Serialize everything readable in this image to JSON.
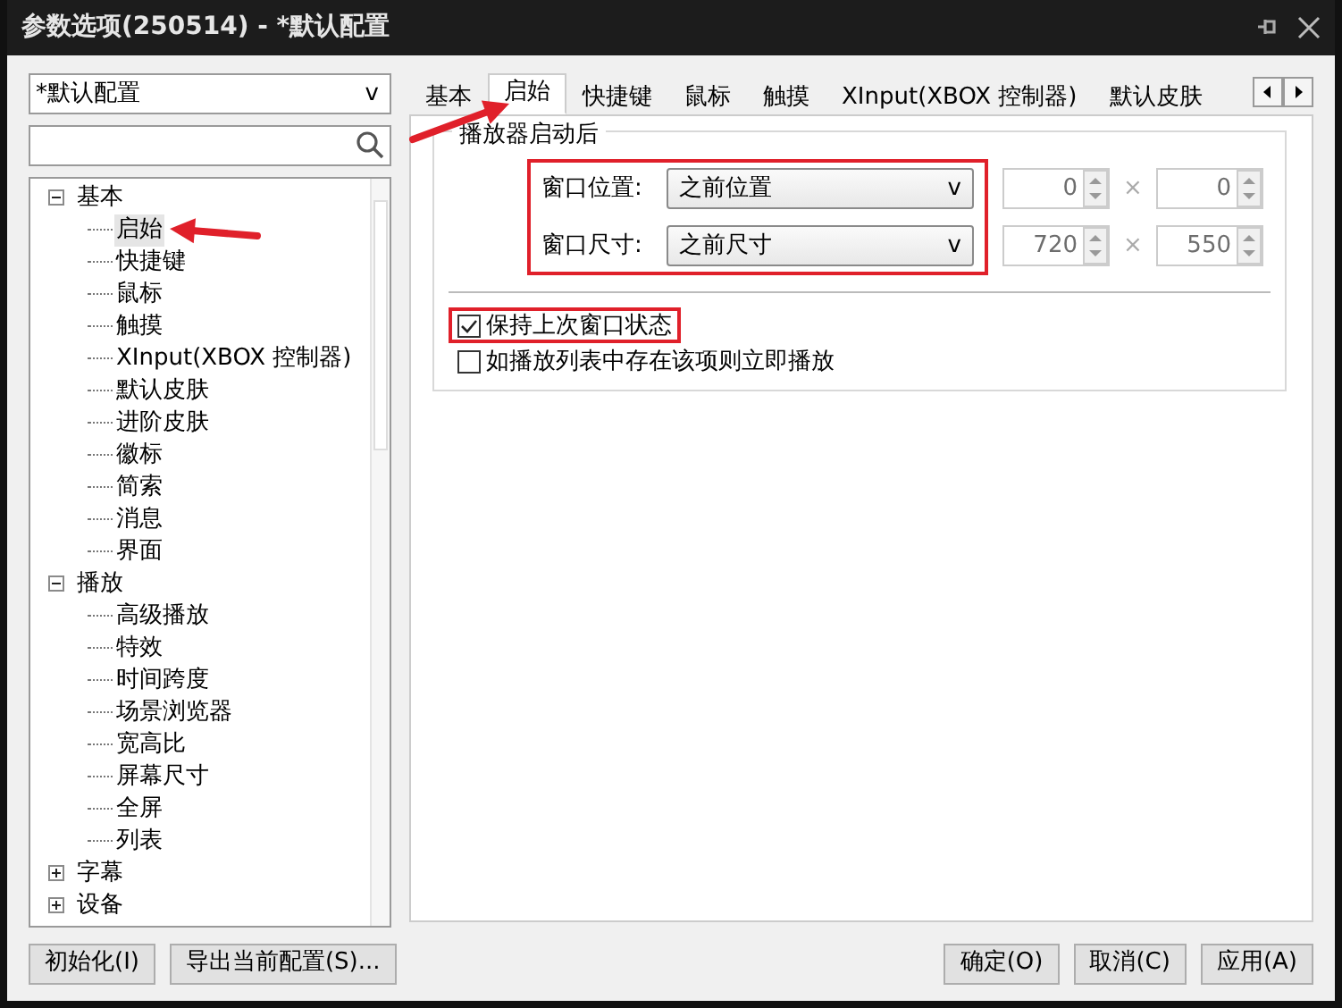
{
  "window": {
    "title": "参数选项(250514) - *默认配置"
  },
  "profile_select": {
    "value": "*默认配置",
    "caret": "v"
  },
  "tree": [
    {
      "label": "基本",
      "expanded": true,
      "selected": false,
      "children": [
        {
          "label": "启始",
          "selected": true
        },
        {
          "label": "快捷键",
          "selected": false
        },
        {
          "label": "鼠标",
          "selected": false
        },
        {
          "label": "触摸",
          "selected": false
        },
        {
          "label": "XInput(XBOX 控制器)",
          "selected": false
        },
        {
          "label": "默认皮肤",
          "selected": false
        },
        {
          "label": "进阶皮肤",
          "selected": false
        },
        {
          "label": "徽标",
          "selected": false
        },
        {
          "label": "简索",
          "selected": false
        },
        {
          "label": "消息",
          "selected": false
        },
        {
          "label": "界面",
          "selected": false
        }
      ]
    },
    {
      "label": "播放",
      "expanded": true,
      "selected": false,
      "children": [
        {
          "label": "高级播放",
          "selected": false
        },
        {
          "label": "特效",
          "selected": false
        },
        {
          "label": "时间跨度",
          "selected": false
        },
        {
          "label": "场景浏览器",
          "selected": false
        },
        {
          "label": "宽高比",
          "selected": false
        },
        {
          "label": "屏幕尺寸",
          "selected": false
        },
        {
          "label": "全屏",
          "selected": false
        },
        {
          "label": "列表",
          "selected": false
        }
      ]
    },
    {
      "label": "字幕",
      "expanded": false,
      "selected": false
    },
    {
      "label": "设备",
      "expanded": false,
      "selected": false
    }
  ],
  "tabs": [
    {
      "label": "基本",
      "selected": false
    },
    {
      "label": "启始",
      "selected": true
    },
    {
      "label": "快捷键",
      "selected": false
    },
    {
      "label": "鼠标",
      "selected": false
    },
    {
      "label": "触摸",
      "selected": false
    },
    {
      "label": "XInput(XBOX 控制器)",
      "selected": false
    },
    {
      "label": "默认皮肤",
      "selected": false
    }
  ],
  "group": {
    "title": "播放器启动后",
    "rows": [
      {
        "label": "窗口位置:",
        "value": "之前位置",
        "caret": "v",
        "spin_a": "0",
        "separator": "×",
        "spin_b": "0",
        "disabled": true
      },
      {
        "label": "窗口尺寸:",
        "value": "之前尺寸",
        "caret": "v",
        "spin_a": "720",
        "separator": "×",
        "spin_b": "550",
        "disabled": true
      }
    ]
  },
  "checkboxes": [
    {
      "label": "保持上次窗口状态",
      "checked": true,
      "highlighted": true
    },
    {
      "label": "如播放列表中存在该项则立即播放",
      "checked": false,
      "highlighted": false
    }
  ],
  "buttons_left": [
    "初始化(I)",
    "导出当前配置(S)..."
  ],
  "buttons_right": [
    "确定(O)",
    "取消(C)",
    "应用(A)"
  ]
}
